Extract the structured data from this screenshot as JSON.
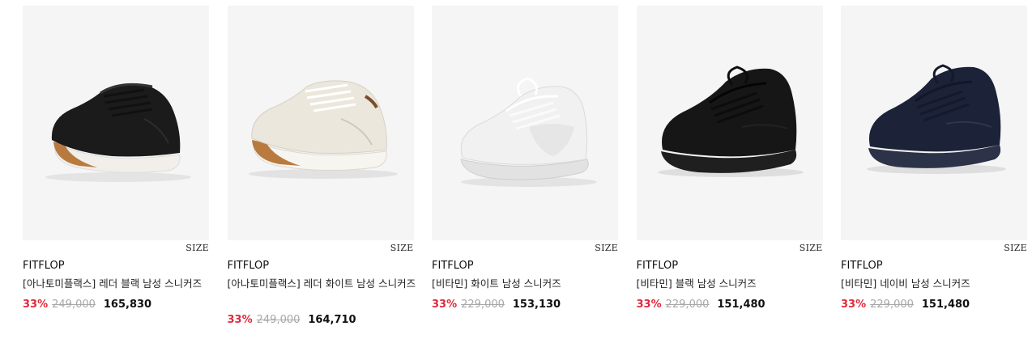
{
  "products": [
    {
      "brand": "FITFLOP",
      "name": "[아나토미플랙스] 레더 블랙 남성 스니커즈",
      "size_label": "SIZE",
      "discount": "33%",
      "original_price": "249,000",
      "sale_price": "165,830",
      "image": {
        "type": "leather-sneaker",
        "upper": "#1b1b1b",
        "sole": "#f2efea",
        "heel": "#b97a3f",
        "lace": "#111111"
      }
    },
    {
      "brand": "FITFLOP",
      "name": "[아나토미플랙스] 레더 화이트 남성 스니커즈",
      "size_label": "SIZE",
      "discount": "33%",
      "original_price": "249,000",
      "sale_price": "164,710",
      "image": {
        "type": "leather-sneaker",
        "upper": "#ece7dc",
        "sole": "#f7f5f0",
        "heel": "#b97a3f",
        "lace": "#ffffff"
      }
    },
    {
      "brand": "FITFLOP",
      "name": "[비타민] 화이트 남성 스니커즈",
      "size_label": "SIZE",
      "discount": "33%",
      "original_price": "229,000",
      "sale_price": "153,130",
      "image": {
        "type": "knit-sneaker",
        "upper": "#f1f1f1",
        "sole": "#e2e2e2",
        "heel": "#dcdcdc",
        "lace": "#ffffff"
      }
    },
    {
      "brand": "FITFLOP",
      "name": "[비타민] 블랙 남성 스니커즈",
      "size_label": "SIZE",
      "discount": "33%",
      "original_price": "229,000",
      "sale_price": "151,480",
      "image": {
        "type": "knit-sneaker",
        "upper": "#161616",
        "sole": "#1f1f1f",
        "heel": "#2a2a2a",
        "lace": "#0c0c0c"
      }
    },
    {
      "brand": "FITFLOP",
      "name": "[비타민] 네이비 남성 스니커즈",
      "size_label": "SIZE",
      "discount": "33%",
      "original_price": "229,000",
      "sale_price": "151,480",
      "image": {
        "type": "knit-sneaker",
        "upper": "#1c2338",
        "sole": "#2c3247",
        "heel": "#2f3550",
        "lace": "#141a2c"
      }
    }
  ],
  "colors": {
    "discount": "#e0283c",
    "original_price": "#a8a8a8",
    "thumb_bg": "#f5f5f5"
  }
}
